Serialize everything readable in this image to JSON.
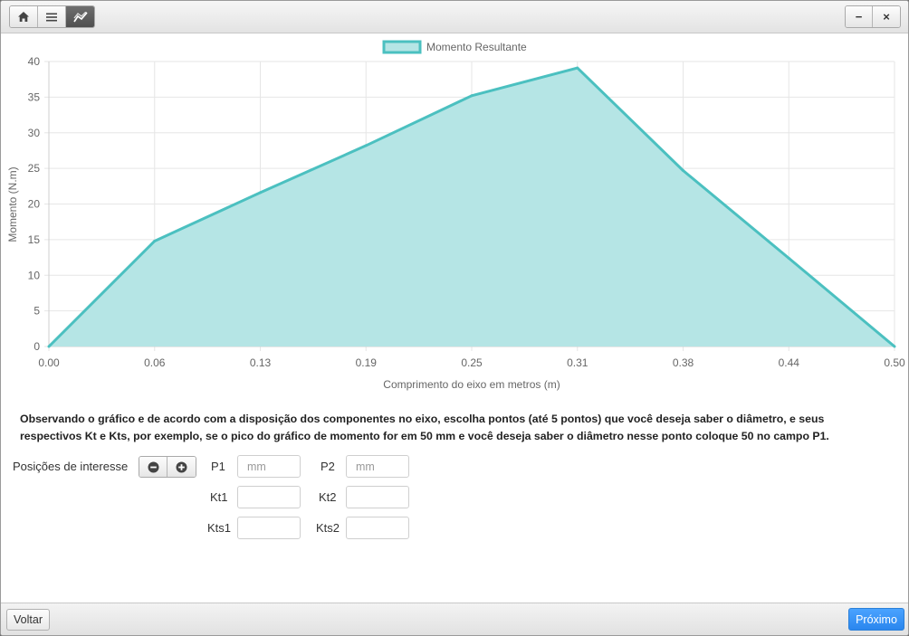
{
  "titlebar": {
    "nav_icons": [
      "home-icon",
      "menu-icon",
      "chart-icon"
    ],
    "minimize_label": "−",
    "close_label": "×"
  },
  "chart_data": {
    "type": "area",
    "title": "",
    "xlabel": "Comprimento do eixo em metros (m)",
    "ylabel": "Momento (N.m)",
    "x_ticks": [
      "0.00",
      "0.06",
      "0.13",
      "0.19",
      "0.25",
      "0.31",
      "0.38",
      "0.44",
      "0.50"
    ],
    "y_ticks": [
      "0",
      "5",
      "10",
      "15",
      "20",
      "25",
      "30",
      "35",
      "40"
    ],
    "ylim": [
      0,
      40
    ],
    "xlim": [
      0,
      0.5
    ],
    "grid": true,
    "legend_position": "top-center",
    "series": [
      {
        "name": "Momento Resultante",
        "x": [
          0.0,
          0.0625,
          0.125,
          0.1875,
          0.25,
          0.3125,
          0.375,
          0.4375,
          0.5
        ],
        "values": [
          0,
          14.8,
          21.6,
          28.2,
          35.2,
          39.1,
          24.7,
          12.4,
          0
        ],
        "line_color": "#4bc0c0",
        "fill_color": "#b5e5e5"
      }
    ]
  },
  "instructions": "Observando o gráfico e de acordo com a disposição dos componentes no eixo, escolha pontos (até 5 pontos) que você deseja saber o diâmetro, e seus respectivos Kt e Kts, por exemplo, se o pico do gráfico de momento for em 50 mm e você deseja saber o diâmetro nesse ponto coloque 50 no campo P1.",
  "form": {
    "positions_label": "Posições de interesse",
    "p1_label": "P1",
    "p1_placeholder": "mm",
    "p2_label": "P2",
    "p2_placeholder": "mm",
    "kt1_label": "Kt1",
    "kt2_label": "Kt2",
    "kts1_label": "Kts1",
    "kts2_label": "Kts2",
    "p1_value": "",
    "p2_value": "",
    "kt1_value": "",
    "kt2_value": "",
    "kts1_value": "",
    "kts2_value": ""
  },
  "footer": {
    "back_label": "Voltar",
    "next_label": "Próximo"
  }
}
